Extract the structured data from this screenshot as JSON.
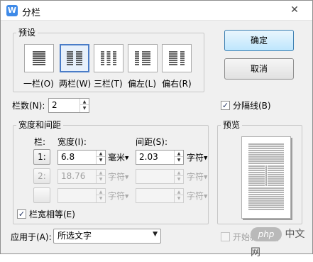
{
  "window": {
    "title": "分栏",
    "app_icon_glyph": "W",
    "close_glyph": "✕"
  },
  "presets": {
    "group_label": "预设",
    "items": [
      {
        "label": "一栏(O)",
        "columns": 1,
        "selected": false
      },
      {
        "label": "两栏(W)",
        "columns": 2,
        "selected": true
      },
      {
        "label": "三栏(T)",
        "columns": 3,
        "selected": false
      },
      {
        "label": "偏左(L)",
        "columns": 2,
        "selected": false
      },
      {
        "label": "偏右(R)",
        "columns": 2,
        "selected": false
      }
    ]
  },
  "buttons": {
    "ok": "确定",
    "cancel": "取消"
  },
  "columns_count": {
    "label": "栏数(N):",
    "value": "2"
  },
  "separator": {
    "label": "分隔线(B)",
    "checked": true
  },
  "width_spacing": {
    "group_label": "宽度和间距",
    "header_col": "栏:",
    "header_width": "宽度(I):",
    "header_spacing": "间距(S):",
    "rows": [
      {
        "num": "1:",
        "width": "6.8",
        "width_unit": "毫米",
        "spacing": "2.03",
        "spacing_unit": "字符",
        "enabled": true
      },
      {
        "num": "2:",
        "width": "18.76",
        "width_unit": "字符",
        "spacing": "",
        "spacing_unit": "字符",
        "enabled": false
      },
      {
        "num": "",
        "width": "",
        "width_unit": "字符",
        "spacing": "",
        "spacing_unit": "字符",
        "enabled": false
      }
    ]
  },
  "equal_width": {
    "label": "栏宽相等(E)",
    "checked": true
  },
  "preview": {
    "group_label": "预览"
  },
  "apply_to": {
    "label": "应用于(A):",
    "value": "所选文字"
  },
  "new_column": {
    "label": "开始新栏(U)",
    "checked": false,
    "enabled": false
  },
  "watermark": {
    "logo": "php",
    "text": "中文网"
  },
  "icons": {
    "app": "wps-writer-icon",
    "close": "close-icon",
    "spin": "spin-arrows-icon",
    "dropdown": "chevron-down-icon",
    "check": "checkmark-icon"
  },
  "colors": {
    "accent": "#3e8ae8",
    "selected_border": "#4a7cc7",
    "dialog_bg": "#f0f0f0"
  }
}
